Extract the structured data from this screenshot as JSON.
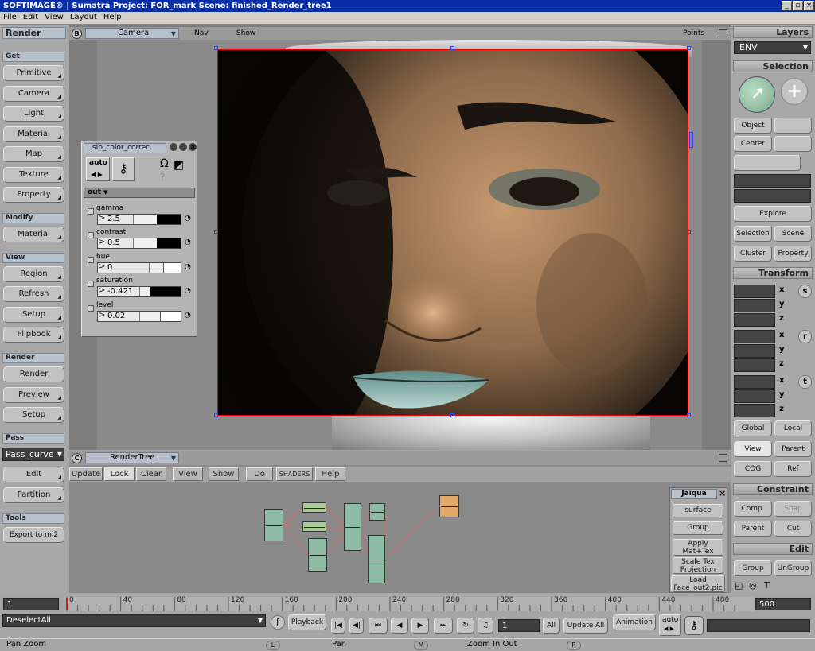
{
  "window": {
    "title": "SOFTIMAGE® | Sumatra Project: FOR_mark     Scene: finished_Render_tree1",
    "controls": [
      "_",
      "▫",
      "×"
    ]
  },
  "menu": [
    "File",
    "Edit",
    "View",
    "Layout",
    "Help"
  ],
  "left_panel": {
    "title": "Render",
    "sections": [
      {
        "label": "Get",
        "buttons": [
          "Primitive",
          "Camera",
          "Light",
          "Material",
          "Map",
          "Texture",
          "Property"
        ]
      },
      {
        "label": "Modify",
        "buttons": [
          "Material"
        ]
      },
      {
        "label": "View",
        "buttons": [
          "Region",
          "Refresh",
          "Setup",
          "Flipbook"
        ]
      },
      {
        "label": "Render",
        "buttons": [
          "Render",
          "Preview",
          "Setup"
        ]
      },
      {
        "label": "Pass",
        "pass_value": "Pass_curve",
        "buttons": [
          "Edit",
          "Partition"
        ]
      },
      {
        "label": "Tools",
        "buttons": [
          "Export to mi2"
        ]
      }
    ]
  },
  "viewport": {
    "badge": "B",
    "camera_label": "Camera",
    "menu": [
      "Nav",
      "Show"
    ],
    "right_label": "Points"
  },
  "prop_editor": {
    "title": "sib_color_correc",
    "auto_label": "auto",
    "out_label": "out",
    "params": [
      {
        "label": "gamma",
        "value": "2.5"
      },
      {
        "label": "contrast",
        "value": "0.5"
      },
      {
        "label": "hue",
        "value": "0"
      },
      {
        "label": "saturation",
        "value": "-0.421"
      },
      {
        "label": "level",
        "value": "0.02"
      }
    ]
  },
  "right_panel": {
    "layers_title": "Layers",
    "layer_value": "ENV",
    "selection_title": "Selection",
    "selection_buttons": [
      "Object",
      "Center"
    ],
    "explore_label": "Explore",
    "filter_buttons": [
      "Selection",
      "Scene",
      "Cluster",
      "Property"
    ],
    "transform_title": "Transform",
    "axes": [
      "x",
      "y",
      "z"
    ],
    "transform_groups": [
      "s",
      "r",
      "t"
    ],
    "ref_buttons": [
      "Global",
      "Local",
      "View",
      "Parent",
      "COG",
      "Ref"
    ],
    "constraint_title": "Constraint",
    "constraint_buttons": [
      "Comp.",
      "Snap",
      "Parent",
      "Cut"
    ],
    "edit_title": "Edit",
    "edit_buttons": [
      "Group",
      "UnGroup"
    ]
  },
  "render_tree": {
    "badge": "C",
    "title": "RenderTree",
    "toolbar": [
      "Update",
      "Lock",
      "Clear",
      "View",
      "Show",
      "Do",
      "SHADERS",
      "Help"
    ],
    "jaiqua": {
      "title": "Jaiqua",
      "buttons": [
        "surface",
        "Group",
        "Apply Mat+Tex",
        "Scale Tex Projection",
        "Load Face_out2.pic"
      ]
    }
  },
  "timeline": {
    "start": "1",
    "end": "500",
    "ticks": [
      "0",
      "40",
      "80",
      "120",
      "160",
      "200",
      "240",
      "280",
      "320",
      "360",
      "400",
      "440",
      "480"
    ]
  },
  "playbar": {
    "command": "DeselectAll",
    "playback_label": "Playback",
    "frame_value": "1",
    "all_label": "All",
    "update_all_label": "Update All",
    "animation_label": "Animation",
    "auto_label": "auto"
  },
  "status": {
    "left": "Pan Zoom",
    "mid": "Pan",
    "right": "Zoom In Out",
    "mouse": [
      "L",
      "M",
      "R"
    ]
  }
}
